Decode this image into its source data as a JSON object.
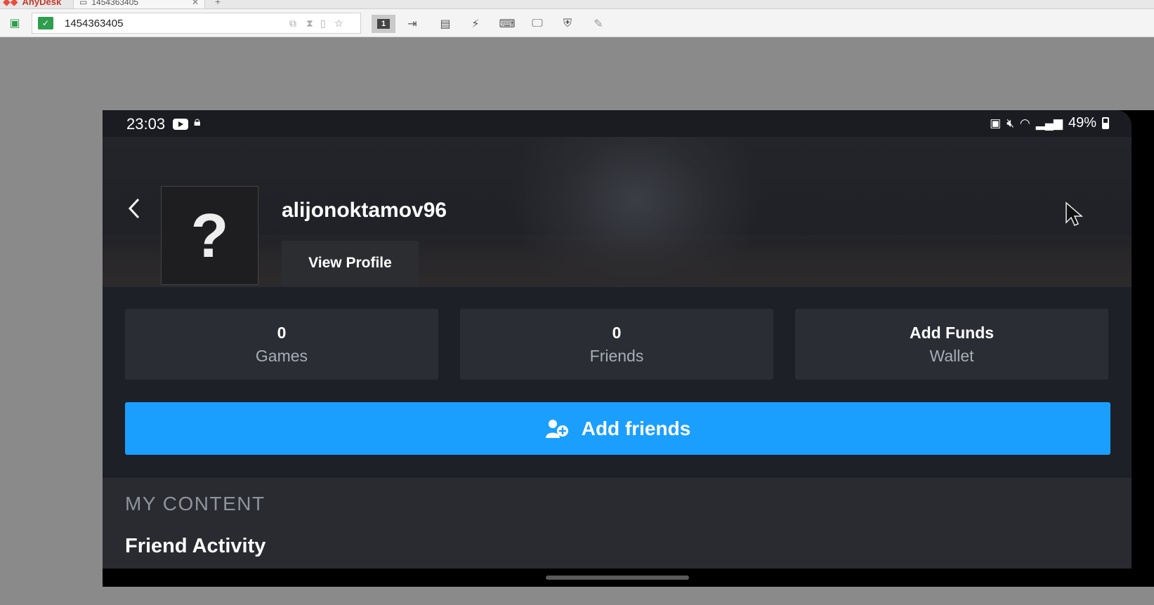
{
  "anydesk": {
    "app_name": "AnyDesk",
    "tab_title": "1454363405",
    "address": "1454363405",
    "display_number": "1"
  },
  "status_bar": {
    "time": "23:03",
    "battery": "49%"
  },
  "profile": {
    "avatar_placeholder": "?",
    "username": "alijonoktamov96",
    "view_profile_label": "View Profile",
    "back_icon": "chevron-left-icon"
  },
  "stats": [
    {
      "value": "0",
      "label": "Games"
    },
    {
      "value": "0",
      "label": "Friends"
    },
    {
      "value": "Add Funds",
      "label": "Wallet"
    }
  ],
  "add_friends": {
    "label": "Add friends",
    "color": "#1a9fff"
  },
  "content": {
    "section_title": "MY CONTENT",
    "friend_activity": "Friend Activity"
  }
}
